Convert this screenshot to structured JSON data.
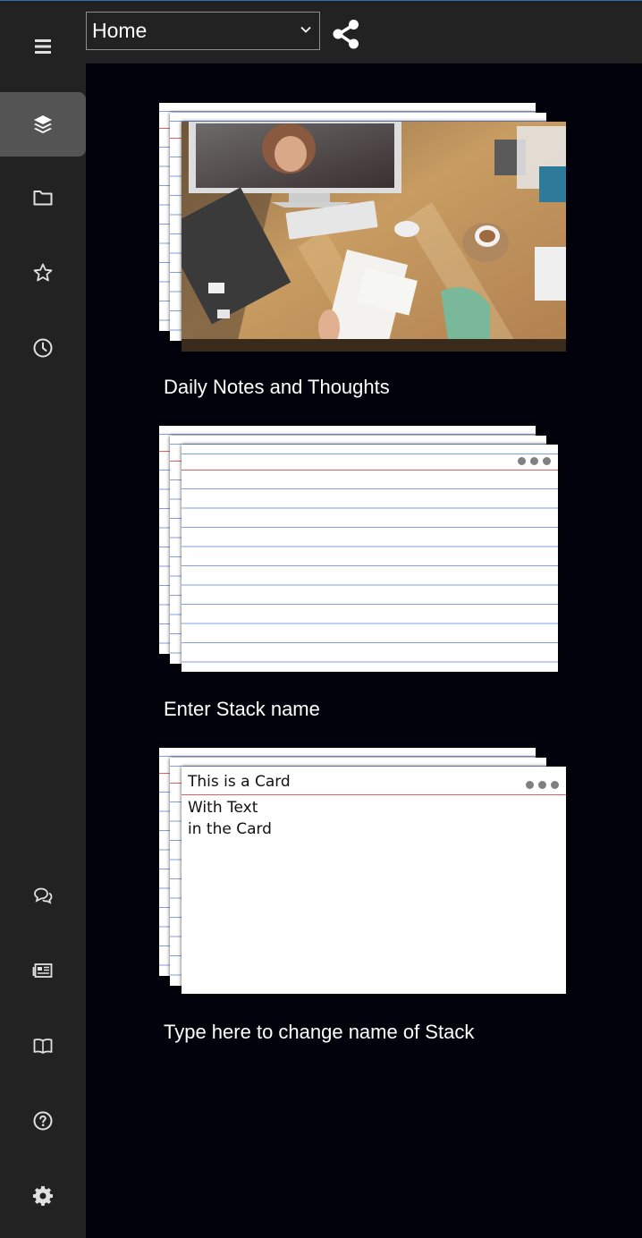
{
  "header": {
    "workspace_select_value": "Home"
  },
  "sidebar": {
    "top_items": [
      {
        "icon": "hamburger-menu-icon"
      },
      {
        "icon": "layers-icon",
        "active": true
      },
      {
        "icon": "folder-icon"
      },
      {
        "icon": "star-icon"
      },
      {
        "icon": "clock-icon"
      }
    ],
    "bottom_items": [
      {
        "icon": "chat-bubbles-icon"
      },
      {
        "icon": "newspaper-icon"
      },
      {
        "icon": "open-book-icon"
      },
      {
        "icon": "help-circle-icon"
      },
      {
        "icon": "gear-icon"
      }
    ]
  },
  "stacks": [
    {
      "name": "Daily Notes and Thoughts",
      "cover": "photo"
    },
    {
      "name": "Enter Stack name",
      "cover": "blank-lined-card"
    },
    {
      "name": "Type here to change name of Stack",
      "cover": "text-card",
      "card": {
        "title": "This is a Card",
        "body_lines": [
          "With Text",
          "in the Card"
        ]
      }
    }
  ],
  "colors": {
    "background": "#02020d",
    "sidebar": "#222222",
    "active_item": "#545454",
    "margin_line": "#e06060",
    "rule_lines": "#7f9fe0"
  }
}
